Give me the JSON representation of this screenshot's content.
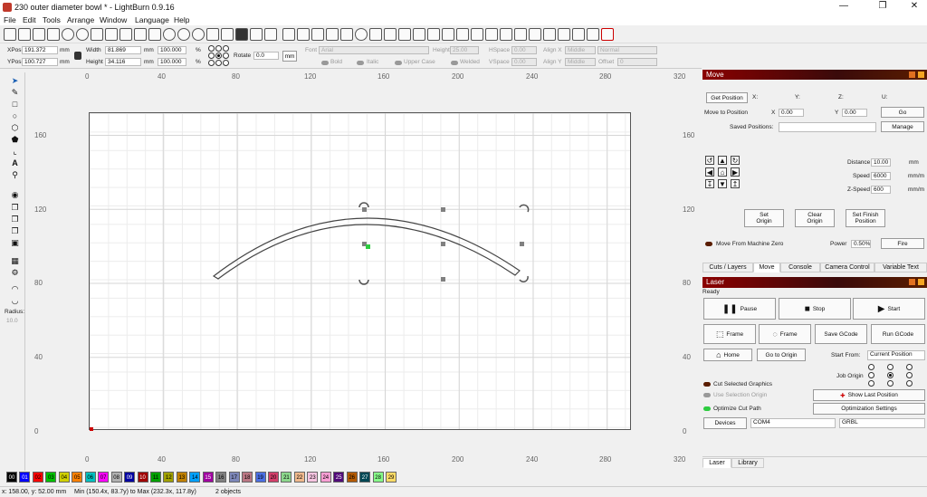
{
  "window": {
    "title": "230 outer diameter bowl * - LightBurn 0.9.16"
  },
  "menu": [
    "File",
    "Edit",
    "Tools",
    "Arrange",
    "Window",
    "Language",
    "Help"
  ],
  "props": {
    "xpos_label": "XPos",
    "xpos": "191.372",
    "ypos_label": "YPos",
    "ypos": "100.727",
    "mm": "mm",
    "width_label": "Width",
    "width": "81.869",
    "height_label": "Height",
    "height": "34.116",
    "scale_w": "100.000",
    "scale_h": "100.000",
    "pct": "%",
    "rotate_label": "Rotate",
    "rotate": "0.0",
    "rotate_unit": "mm",
    "font_label": "Font",
    "font_value": "Arial",
    "font_height_label": "Height",
    "font_height": "25.00",
    "hspace_label": "HSpace",
    "hspace": "0.00",
    "vspace_label": "VSpace",
    "vspace": "0.00",
    "align_x_label": "Align X",
    "align_x": "Middle",
    "align_y_label": "Align Y",
    "align_y": "Middle",
    "style": "Normal",
    "offset_label": "Offset",
    "offset": "0",
    "bold": "Bold",
    "italic": "Italic",
    "upper": "Upper Case",
    "welded": "Welded"
  },
  "left_tools": {
    "radius_label": "Radius:",
    "radius": "10.0"
  },
  "rulers": {
    "x": [
      "0",
      "40",
      "80",
      "120",
      "160",
      "200",
      "240",
      "280",
      "320"
    ],
    "y": [
      "160",
      "120",
      "80",
      "40",
      "0"
    ],
    "y_right": [
      "160",
      "120",
      "80",
      "40",
      "0"
    ]
  },
  "palette": [
    {
      "n": "00",
      "c": "#000000",
      "t": "#ffffff"
    },
    {
      "n": "01",
      "c": "#0000ff",
      "t": "#ffffff"
    },
    {
      "n": "02",
      "c": "#ff0000",
      "t": "#000000"
    },
    {
      "n": "03",
      "c": "#00c000",
      "t": "#000000"
    },
    {
      "n": "04",
      "c": "#d0d000",
      "t": "#000000"
    },
    {
      "n": "05",
      "c": "#ff8000",
      "t": "#000000"
    },
    {
      "n": "06",
      "c": "#00c0c0",
      "t": "#000000"
    },
    {
      "n": "07",
      "c": "#ff00ff",
      "t": "#000000"
    },
    {
      "n": "08",
      "c": "#b0b0b0",
      "t": "#000000"
    },
    {
      "n": "09",
      "c": "#0000a0",
      "t": "#ffffff"
    },
    {
      "n": "10",
      "c": "#a00000",
      "t": "#ffffff"
    },
    {
      "n": "11",
      "c": "#00a000",
      "t": "#000000"
    },
    {
      "n": "12",
      "c": "#a0a000",
      "t": "#000000"
    },
    {
      "n": "13",
      "c": "#c08000",
      "t": "#000000"
    },
    {
      "n": "14",
      "c": "#00a0ff",
      "t": "#000000"
    },
    {
      "n": "15",
      "c": "#a000a0",
      "t": "#ffffff"
    },
    {
      "n": "16",
      "c": "#808080",
      "t": "#000000"
    },
    {
      "n": "17",
      "c": "#7d87b9",
      "t": "#000000"
    },
    {
      "n": "18",
      "c": "#bb7784",
      "t": "#000000"
    },
    {
      "n": "19",
      "c": "#4a6fe3",
      "t": "#000000"
    },
    {
      "n": "20",
      "c": "#d33f6a",
      "t": "#000000"
    },
    {
      "n": "21",
      "c": "#8cd78c",
      "t": "#000000"
    },
    {
      "n": "22",
      "c": "#f0b98d",
      "t": "#000000"
    },
    {
      "n": "23",
      "c": "#f6c4e1",
      "t": "#000000"
    },
    {
      "n": "24",
      "c": "#fa9ed4",
      "t": "#000000"
    },
    {
      "n": "25",
      "c": "#500a78",
      "t": "#ffffff"
    },
    {
      "n": "26",
      "c": "#b45a00",
      "t": "#000000"
    },
    {
      "n": "27",
      "c": "#004754",
      "t": "#ffffff"
    },
    {
      "n": "28",
      "c": "#86fa88",
      "t": "#000000"
    },
    {
      "n": "29",
      "c": "#ffdb66",
      "t": "#000000"
    }
  ],
  "status": {
    "cursor": "x: 158.00, y: 52.00 mm",
    "bounds": "Min (150.4x, 83.7y) to Max (232.3x, 117.8y)",
    "objects": "2 objects"
  },
  "move_panel": {
    "title": "Move",
    "get_position": "Get Position",
    "x": "X:",
    "y": "Y:",
    "z": "Z:",
    "u": "U:",
    "move_to_position": "Move to Position",
    "mx_label": "X",
    "mx": "0.00",
    "my_label": "Y",
    "my": "0.00",
    "go": "Go",
    "saved_positions": "Saved Positions:",
    "manage": "Manage",
    "distance_label": "Distance",
    "distance": "10.00",
    "distance_unit": "mm",
    "speed_label": "Speed",
    "speed": "6000",
    "speed_unit": "mm/m",
    "zspeed_label": "Z-Speed",
    "zspeed": "600",
    "zspeed_unit": "mm/m",
    "set_origin": "Set Origin",
    "clear_origin": "Clear Origin",
    "set_finish": "Set Finish Position",
    "from_zero": "Move From Machine Zero",
    "power_label": "Power",
    "power": "0.50%",
    "fire": "Fire",
    "tabs": [
      "Cuts / Layers",
      "Move",
      "Console",
      "Camera Control",
      "Variable Text"
    ]
  },
  "laser_panel": {
    "title": "Laser",
    "state": "Ready",
    "pause": "Pause",
    "stop": "Stop",
    "start": "Start",
    "frame1": "Frame",
    "frame2": "Frame",
    "save_gcode": "Save GCode",
    "run_gcode": "Run GCode",
    "home": "Home",
    "go_origin": "Go to Origin",
    "start_from_label": "Start From:",
    "start_from": "Current Position",
    "job_origin": "Job Origin",
    "cut_selected": "Cut Selected Graphics",
    "use_selection": "Use Selection Origin",
    "show_last": "Show Last Position",
    "optimize": "Optimize Cut Path",
    "opt_settings": "Optimization Settings",
    "devices": "Devices",
    "port": "COM4",
    "controller": "GRBL",
    "tabs": [
      "Laser",
      "Library"
    ]
  },
  "colors": {
    "accent": "#8b0000",
    "selection": "#808080",
    "handle_green": "#2ecc40"
  }
}
